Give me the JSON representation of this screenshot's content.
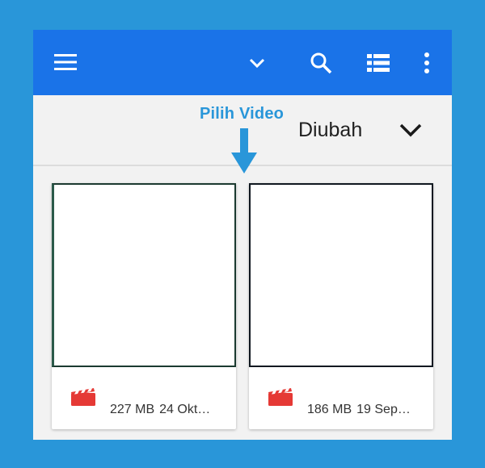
{
  "annotation": {
    "label": "Pilih Video",
    "color": "#2996d9"
  },
  "appbar": {
    "color": "#1a73e8",
    "icons": [
      "menu-icon",
      "chevron-down-icon",
      "search-icon",
      "list-view-icon",
      "more-vert-icon"
    ]
  },
  "sort": {
    "label": "Diubah",
    "icon": "chevron-down-icon"
  },
  "files": [
    {
      "size": "227 MB",
      "date": "24 Okt…",
      "icon": "video-file-icon"
    },
    {
      "size": "186 MB",
      "date": "19 Sep…",
      "icon": "video-file-icon"
    }
  ],
  "colors": {
    "background": "#2996d9",
    "video_icon": "#e53935"
  }
}
